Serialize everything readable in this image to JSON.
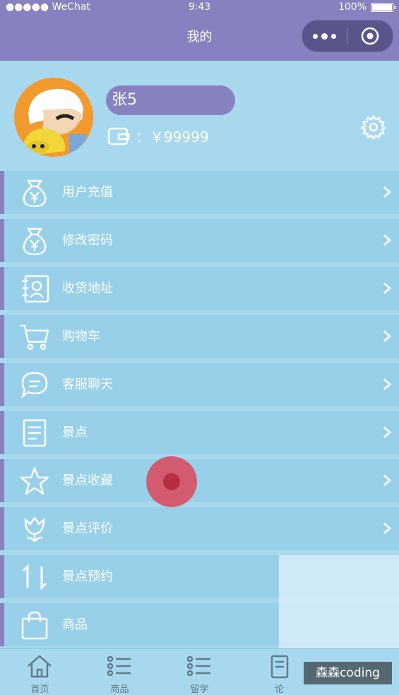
{
  "status_bar": {
    "carrier": "●●●●● WeChat",
    "time": "9:43",
    "battery": "100%"
  },
  "nav": {
    "title": "我的"
  },
  "profile": {
    "name": "张5",
    "wallet_label": "：￥99999"
  },
  "menu": [
    {
      "label": "用户充值",
      "icon": "money-bag-icon",
      "chevron": true
    },
    {
      "label": "修改密码",
      "icon": "money-bag-icon",
      "chevron": true
    },
    {
      "label": "收货地址",
      "icon": "address-book-icon",
      "chevron": true
    },
    {
      "label": "购物车",
      "icon": "cart-icon",
      "chevron": true
    },
    {
      "label": "客服聊天",
      "icon": "chat-icon",
      "chevron": true
    },
    {
      "label": "景点",
      "icon": "document-icon",
      "chevron": true
    },
    {
      "label": "景点收藏",
      "icon": "star-icon",
      "chevron": true
    },
    {
      "label": "景点评价",
      "icon": "tulip-icon",
      "chevron": true
    },
    {
      "label": "景点预约",
      "icon": "sort-arrows-icon",
      "chevron": false
    },
    {
      "label": "商品",
      "icon": "shopping-bag-icon",
      "chevron": false
    }
  ],
  "tabs": [
    {
      "label": "首页",
      "icon": "home-icon"
    },
    {
      "label": "商品",
      "icon": "list-icon"
    },
    {
      "label": "留学",
      "icon": "list-icon"
    },
    {
      "label": "论",
      "icon": "document-icon"
    },
    {
      "label": "",
      "icon": ""
    }
  ],
  "watermark": "森森coding",
  "colors": {
    "purple": "#8781c0",
    "row": "#98d0ea",
    "page": "#a7d8ee",
    "touch": "#dc465a"
  }
}
